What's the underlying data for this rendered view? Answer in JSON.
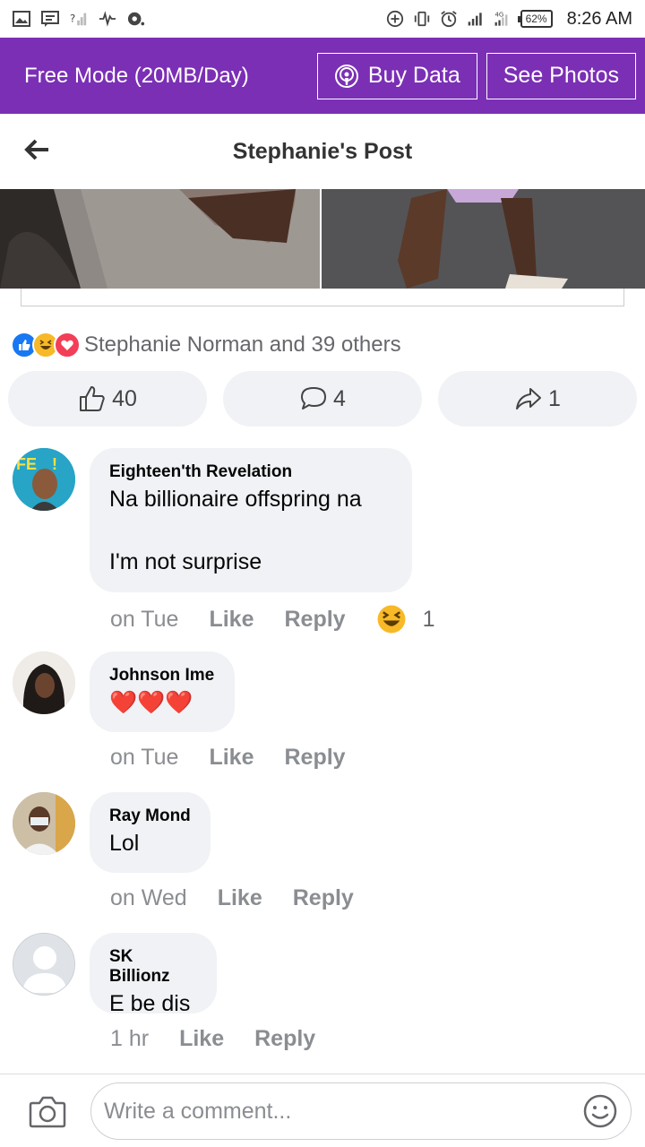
{
  "status_bar": {
    "battery": "62%",
    "time": "8:26 AM",
    "network": "4G"
  },
  "free_mode": {
    "label": "Free Mode (20MB/Day)",
    "buy_data": "Buy Data",
    "see_photos": "See Photos"
  },
  "header": {
    "title": "Stephanie's Post"
  },
  "post": {
    "reaction_summary": "Stephanie Norman and 39 others",
    "like_count": "40",
    "comment_count": "4",
    "share_count": "1"
  },
  "comments": [
    {
      "author": "Eighteen'th Revelation",
      "text_line1": "Na billionaire offspring na",
      "text_line2": "I'm not surprise",
      "time": "on Tue",
      "like": "Like",
      "reply": "Reply",
      "reaction_count": "1"
    },
    {
      "author": "Johnson Ime",
      "text": "❤️❤️❤️",
      "time": "on Tue",
      "like": "Like",
      "reply": "Reply"
    },
    {
      "author": "Ray Mond",
      "text": "Lol",
      "time": "on Wed",
      "like": "Like",
      "reply": "Reply"
    },
    {
      "author": "SK Billionz",
      "text": "E be dis",
      "time": "1 hr",
      "like": "Like",
      "reply": "Reply"
    }
  ],
  "composer": {
    "placeholder": "Write a comment..."
  },
  "colors": {
    "brand": "#7b2fb5",
    "bubble": "#f0f2f5",
    "like_blue": "#1877f2",
    "love_red": "#f33e58"
  }
}
